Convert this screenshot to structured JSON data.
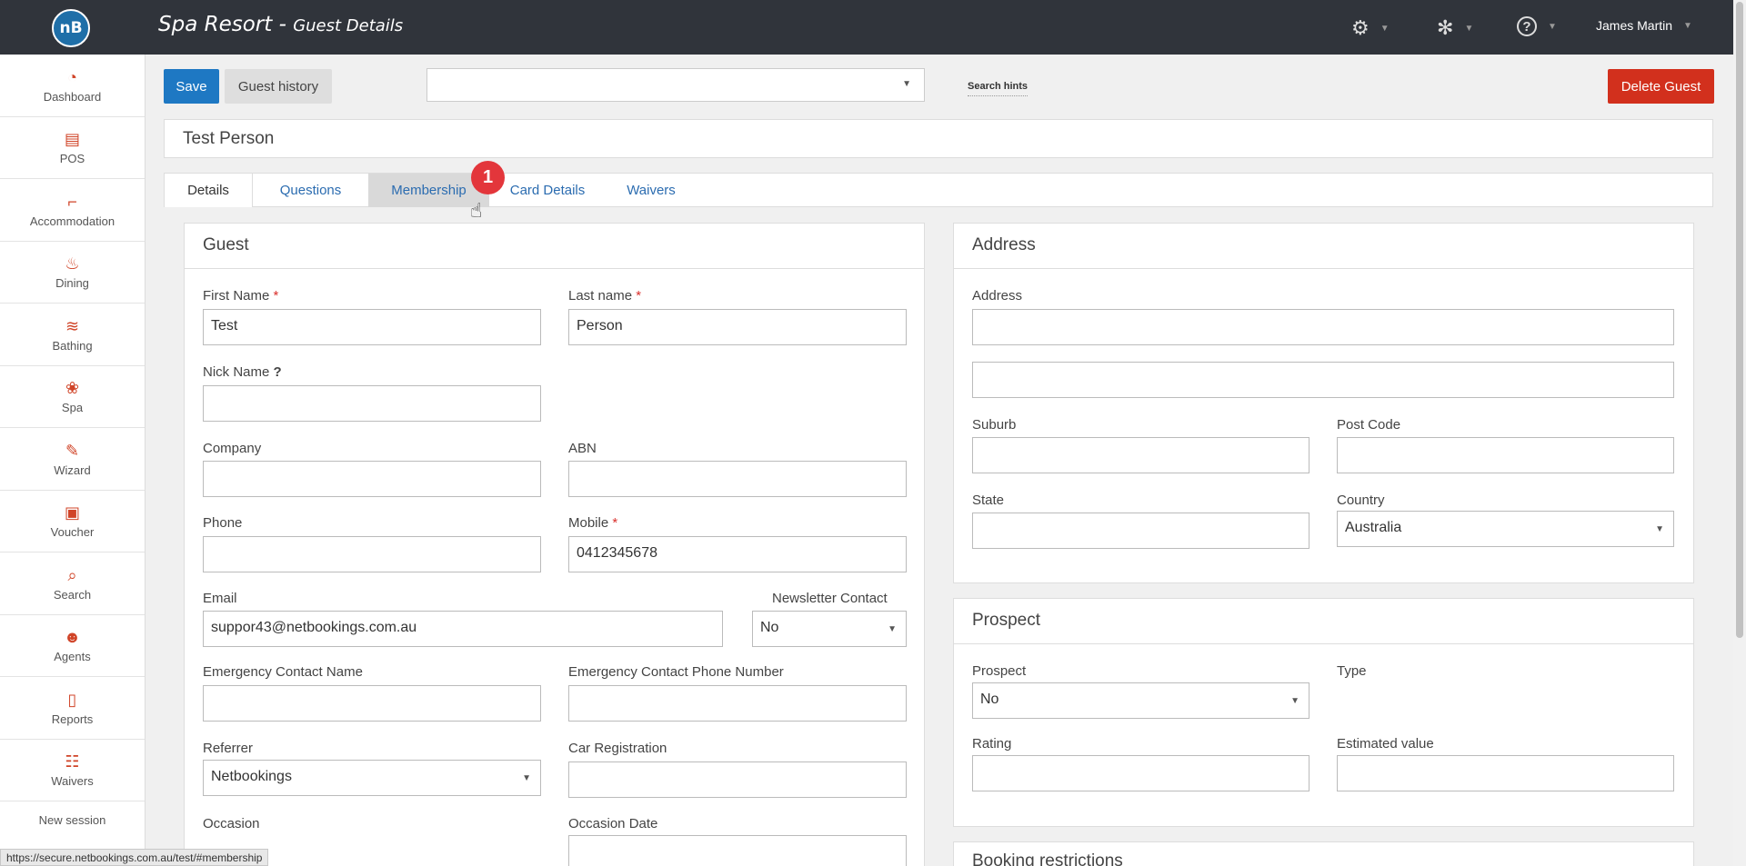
{
  "topbar": {
    "logo": "nB",
    "title": "Spa Resort - ",
    "subtitle": "Guest Details",
    "settings_icon": "⚙",
    "fan_icon": "✻",
    "help_icon": "?",
    "user": "James Martin"
  },
  "sidebar": {
    "items": [
      {
        "label": "Dashboard",
        "icon": "◔"
      },
      {
        "label": "POS",
        "icon": "▤"
      },
      {
        "label": "Accommodation",
        "icon": "⌐"
      },
      {
        "label": "Dining",
        "icon": "♨"
      },
      {
        "label": "Bathing",
        "icon": "≋"
      },
      {
        "label": "Spa",
        "icon": "❀"
      },
      {
        "label": "Wizard",
        "icon": "✎"
      },
      {
        "label": "Voucher",
        "icon": "▣"
      },
      {
        "label": "Search",
        "icon": "⌕"
      },
      {
        "label": "Agents",
        "icon": "☻"
      },
      {
        "label": "Reports",
        "icon": "▯"
      },
      {
        "label": "Waivers",
        "icon": "☷"
      }
    ],
    "new_session": "New session"
  },
  "toolbar": {
    "save": "Save",
    "history": "Guest history",
    "search_hints": "Search hints",
    "delete": "Delete Guest"
  },
  "guest_name": "Test Person",
  "tabs": {
    "details": "Details",
    "questions": "Questions",
    "membership": "Membership",
    "card": "Card Details",
    "waivers": "Waivers",
    "badge": "1"
  },
  "guest": {
    "heading": "Guest",
    "first_name_label": "First Name",
    "first_name": "Test",
    "last_name_label": "Last name",
    "last_name": "Person",
    "nick_name_label": "Nick Name",
    "nick_name_hint": "?",
    "company_label": "Company",
    "abn_label": "ABN",
    "phone_label": "Phone",
    "mobile_label": "Mobile",
    "mobile": "0412345678",
    "email_label": "Email",
    "email": "suppor43@netbookings.com.au",
    "newsletter_label": "Newsletter Contact",
    "newsletter": "No",
    "emergency_name_label": "Emergency Contact Name",
    "emergency_phone_label": "Emergency Contact Phone Number",
    "referrer_label": "Referrer",
    "referrer": "Netbookings",
    "car_label": "Car Registration",
    "occasion_label": "Occasion",
    "occasion_date_label": "Occasion Date",
    "required_mark": "*"
  },
  "address": {
    "heading": "Address",
    "address_label": "Address",
    "suburb_label": "Suburb",
    "postcode_label": "Post Code",
    "state_label": "State",
    "country_label": "Country",
    "country": "Australia"
  },
  "prospect": {
    "heading": "Prospect",
    "prospect_label": "Prospect",
    "prospect": "No",
    "type_label": "Type",
    "rating_label": "Rating",
    "estimated_label": "Estimated value"
  },
  "booking_restrictions": "Booking restrictions",
  "status_url": "https://secure.netbookings.com.au/test/#membership"
}
